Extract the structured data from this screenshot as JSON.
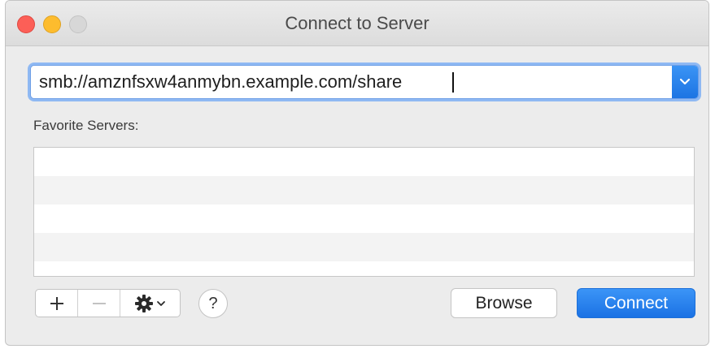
{
  "window": {
    "title": "Connect to Server"
  },
  "address": {
    "value": "smb://amznfsxw4anmybn.example.com/share"
  },
  "favorites": {
    "label": "Favorite Servers:",
    "items": []
  },
  "toolbar": {
    "add_icon": "plus-icon",
    "remove_icon": "minus-icon",
    "action_icon": "gear-icon",
    "help_label": "?"
  },
  "buttons": {
    "browse_label": "Browse",
    "connect_label": "Connect"
  },
  "colors": {
    "accent": "#1d74e4",
    "close": "#fc5f57",
    "minimize": "#fdbc2e",
    "zoom_disabled": "#d7d7d7"
  }
}
